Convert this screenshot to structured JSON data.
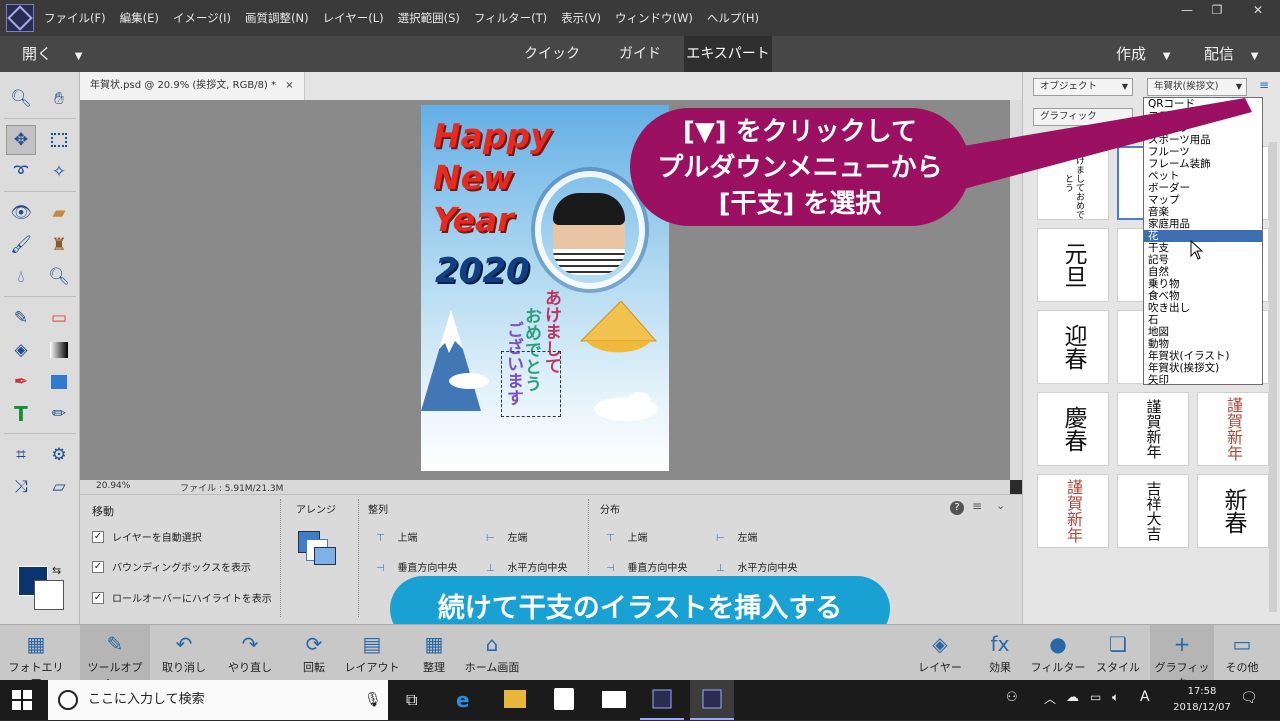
{
  "menu": {
    "items": [
      "ファイル(F)",
      "編集(E)",
      "イメージ(I)",
      "画質調整(N)",
      "レイヤー(L)",
      "選択範囲(S)",
      "フィルター(T)",
      "表示(V)",
      "ウィンドウ(W)",
      "ヘルプ(H)"
    ],
    "window_buttons": [
      "—",
      "❐",
      "✕"
    ]
  },
  "modebar": {
    "open": "開く",
    "tabs": [
      "クイック",
      "ガイド",
      "エキスパート"
    ],
    "active_tab": "エキスパート",
    "create": "作成",
    "share": "配信"
  },
  "document": {
    "tab_title": "年賀状.psd @ 20.9% (挨拶文, RGB/8) *",
    "tab_close": "×",
    "zoom": "20.94%",
    "file_info": "ファイル : 5.91M/21.3M"
  },
  "card": {
    "line1": "Happy",
    "line2": "New",
    "line3": "Year",
    "year": "2020",
    "vertical_lines": [
      "あけまして",
      "おめでとう",
      "ございます"
    ]
  },
  "tool_options": {
    "move_title": "移動",
    "checkboxes": [
      "レイヤーを自動選択",
      "バウンディングボックスを表示",
      "ロールオーバーにハイライトを表示"
    ],
    "arrange": "アレンジ",
    "align": "整列",
    "align_items": [
      "上端",
      "左端",
      "垂直方向中央",
      "水平方向中央"
    ],
    "distribute": "分布",
    "distribute_items": [
      "上端",
      "左端",
      "垂直方向中央",
      "水平方向中央"
    ]
  },
  "right_panel": {
    "object_dropdown": "オブジェクト",
    "category_dropdown": "年賀状(挨拶文)",
    "graphic_dropdown": "グラフィック",
    "thumbs_row1": [
      "明けましておめでとう",
      "",
      ""
    ],
    "thumbs_row2": [
      "元旦",
      "",
      ""
    ],
    "thumbs_row3": [
      "迎春",
      "",
      ""
    ],
    "thumbs_row4": [
      "慶春",
      "謹賀新年",
      "謹賀新年"
    ],
    "thumbs_row5": [
      "謹賀新年",
      "吉祥大吉",
      "新春"
    ]
  },
  "dropdown_menu": {
    "items": [
      "QRコード",
      "コスチューム",
      "シェイプ",
      "スポーツ用品",
      "フルーツ",
      "フレーム装飾",
      "ペット",
      "ボーダー",
      "マップ",
      "音楽",
      "家庭用品",
      "花",
      "干支",
      "記号",
      "自然",
      "乗り物",
      "食べ物",
      "吹き出し",
      "石",
      "地図",
      "動物",
      "年賀状(イラスト)",
      "年賀状(挨拶文)",
      "矢印"
    ],
    "highlighted": "花"
  },
  "callout": {
    "line1": "[▼] をクリックして",
    "line2": "プルダウンメニューから",
    "line3": "[干支] を選択"
  },
  "banner": {
    "text": "続けて干支のイラストを挿入する"
  },
  "taskbin": {
    "left": [
      {
        "label": "フォトエリア",
        "icon": "photo-bin-icon"
      },
      {
        "label": "ツールオプシ...",
        "icon": "tool-options-icon"
      },
      {
        "label": "取り消し",
        "icon": "undo-icon"
      },
      {
        "label": "やり直し",
        "icon": "redo-icon"
      },
      {
        "label": "回転",
        "icon": "rotate-icon"
      },
      {
        "label": "レイアウト",
        "icon": "layout-icon"
      },
      {
        "label": "整理",
        "icon": "organize-icon"
      },
      {
        "label": "ホーム画面",
        "icon": "home-icon"
      }
    ],
    "right": [
      {
        "label": "レイヤー",
        "icon": "layers-icon"
      },
      {
        "label": "効果",
        "icon": "fx-icon"
      },
      {
        "label": "フィルター",
        "icon": "filter-icon"
      },
      {
        "label": "スタイル",
        "icon": "style-icon"
      },
      {
        "label": "グラフィック",
        "icon": "graphics-icon"
      },
      {
        "label": "その他",
        "icon": "more-icon"
      }
    ]
  },
  "windows_taskbar": {
    "search_placeholder": "ここに入力して検索",
    "time": "17:58",
    "date": "2018/12/07",
    "ime": "A"
  },
  "colors": {
    "callout": "#9b1060",
    "banner": "#1aa1d3",
    "foreground_swatch": "#0a3370",
    "highlight": "#3d6fb0"
  }
}
